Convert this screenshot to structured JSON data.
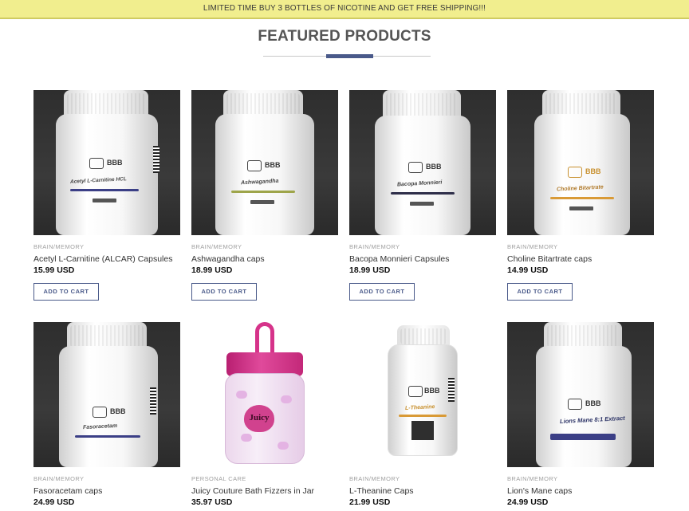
{
  "promo": {
    "text": "LIMITED TIME BUY 3 BOTTLES OF NICOTINE AND GET FREE SHIPPING!!!"
  },
  "section": {
    "title": "FEATURED PRODUCTS"
  },
  "colors": {
    "accent": "#4a5a8a",
    "promo_bg": "#f1ee8e"
  },
  "products": [
    {
      "category": "BRAIN/MEMORY",
      "name": "Acetyl L-Carnitine (ALCAR) Capsules",
      "price": "15.99 USD",
      "button": "ADD TO CART",
      "label": "Acetyl L-Carnitine HCL",
      "logo": "BBB"
    },
    {
      "category": "BRAIN/MEMORY",
      "name": "Ashwagandha caps",
      "price": "18.99 USD",
      "button": "ADD TO CART",
      "label": "Ashwagandha",
      "logo": "BBB"
    },
    {
      "category": "BRAIN/MEMORY",
      "name": "Bacopa Monnieri Capsules",
      "price": "18.99 USD",
      "button": "ADD TO CART",
      "label": "Bacopa Monnieri",
      "logo": "BBB"
    },
    {
      "category": "BRAIN/MEMORY",
      "name": "Choline Bitartrate caps",
      "price": "14.99 USD",
      "button": "ADD TO CART",
      "label": "Choline Bitartrate",
      "logo": "BBB"
    },
    {
      "category": "BRAIN/MEMORY",
      "name": "Fasoracetam caps",
      "price": "24.99 USD",
      "label": "Fasoracetam",
      "logo": "BBB"
    },
    {
      "category": "PERSONAL CARE",
      "name": "Juicy Couture Bath Fizzers in Jar",
      "price": "35.97 USD",
      "label": "Juicy"
    },
    {
      "category": "BRAIN/MEMORY",
      "name": "L-Theanine Caps",
      "price": "21.99 USD",
      "label": "L-Theanine",
      "logo": "BBB"
    },
    {
      "category": "BRAIN/MEMORY",
      "name": "Lion's Mane caps",
      "price": "24.99 USD",
      "label": "Lions Mane 8:1 Extract",
      "logo": "BBB"
    }
  ]
}
